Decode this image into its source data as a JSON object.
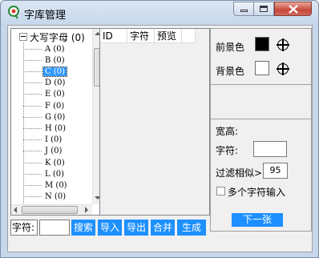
{
  "window": {
    "title": "字库管理"
  },
  "tree": {
    "root_label": "大写字母 (0)",
    "items": [
      "A (0)",
      "B (0)",
      "C (0)",
      "D (0)",
      "E (0)",
      "F (0)",
      "G (0)",
      "H (0)",
      "I (0)",
      "J (0)",
      "K (0)",
      "L (0)",
      "M (0)",
      "N (0)"
    ],
    "selected": "C (0)"
  },
  "list": {
    "columns": [
      "ID",
      "字符",
      "预览"
    ]
  },
  "panel": {
    "fg_label": "前景色",
    "fg_color": "#000000",
    "bg_label": "背景色",
    "bg_color": "#ffffff",
    "size_label": "宽高:",
    "char_label": "字符:",
    "char_value": "",
    "filter_label": "过滤相似>",
    "filter_value": "95",
    "multi_label": "多个字符输入",
    "next_label": "下一张"
  },
  "bottom": {
    "char_label": "字符:",
    "char_value": "",
    "buttons": [
      "搜索",
      "导入",
      "导出",
      "合并",
      "生成"
    ]
  },
  "colors": {
    "accent": "#1e90ff",
    "selection": "#3399ff"
  }
}
